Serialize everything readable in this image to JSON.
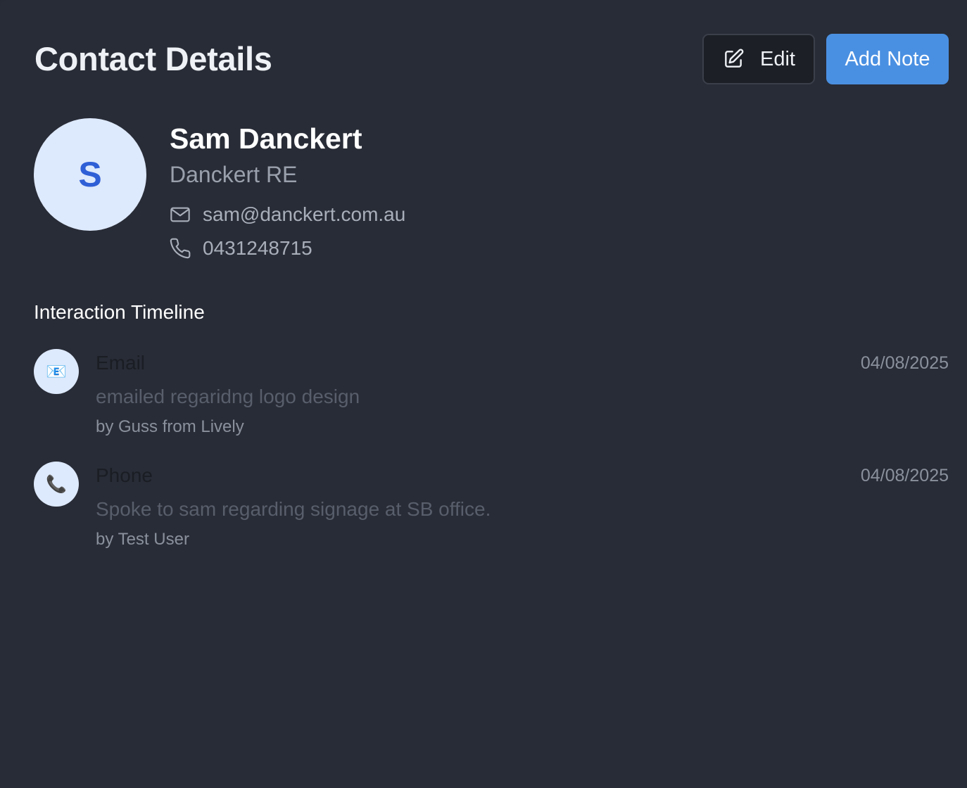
{
  "header": {
    "title": "Contact Details",
    "edit_label": "Edit",
    "add_note_label": "Add Note"
  },
  "contact": {
    "initial": "S",
    "name": "Sam Danckert",
    "company": "Danckert RE",
    "email": "sam@danckert.com.au",
    "phone": "0431248715"
  },
  "timeline": {
    "title": "Interaction Timeline",
    "items": [
      {
        "type": "Email",
        "icon": "envelope-emoji-icon",
        "glyph": "📧",
        "date": "04/08/2025",
        "description": "emailed regaridng logo design",
        "author": "by Guss from Lively"
      },
      {
        "type": "Phone",
        "icon": "telephone-emoji-icon",
        "glyph": "📞",
        "date": "04/08/2025",
        "description": "Spoke to sam regarding signage at SB office.",
        "author": "by Test User"
      }
    ]
  },
  "colors": {
    "background": "#282c36",
    "primary": "#4a90e2",
    "avatar_bg": "#dde9fc",
    "avatar_text": "#2f5fd6"
  }
}
